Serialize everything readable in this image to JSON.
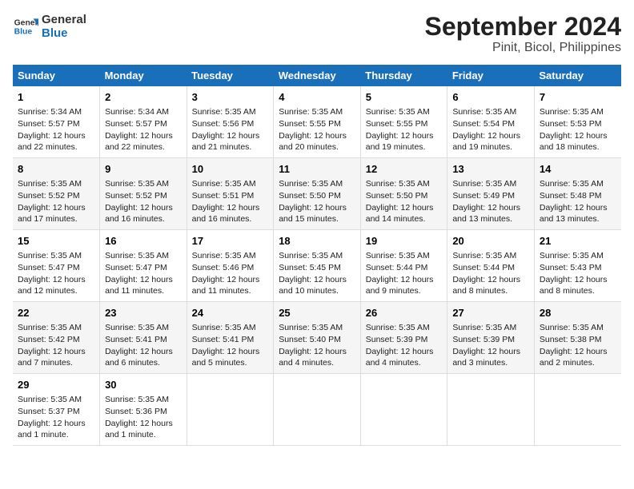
{
  "header": {
    "logo_line1": "General",
    "logo_line2": "Blue",
    "title": "September 2024",
    "subtitle": "Pinit, Bicol, Philippines"
  },
  "days_of_week": [
    "Sunday",
    "Monday",
    "Tuesday",
    "Wednesday",
    "Thursday",
    "Friday",
    "Saturday"
  ],
  "weeks": [
    [
      {
        "day": "1",
        "sunrise": "5:34 AM",
        "sunset": "5:57 PM",
        "daylight": "12 hours and 22 minutes."
      },
      {
        "day": "2",
        "sunrise": "5:34 AM",
        "sunset": "5:57 PM",
        "daylight": "12 hours and 22 minutes."
      },
      {
        "day": "3",
        "sunrise": "5:35 AM",
        "sunset": "5:56 PM",
        "daylight": "12 hours and 21 minutes."
      },
      {
        "day": "4",
        "sunrise": "5:35 AM",
        "sunset": "5:55 PM",
        "daylight": "12 hours and 20 minutes."
      },
      {
        "day": "5",
        "sunrise": "5:35 AM",
        "sunset": "5:55 PM",
        "daylight": "12 hours and 19 minutes."
      },
      {
        "day": "6",
        "sunrise": "5:35 AM",
        "sunset": "5:54 PM",
        "daylight": "12 hours and 19 minutes."
      },
      {
        "day": "7",
        "sunrise": "5:35 AM",
        "sunset": "5:53 PM",
        "daylight": "12 hours and 18 minutes."
      }
    ],
    [
      {
        "day": "8",
        "sunrise": "5:35 AM",
        "sunset": "5:52 PM",
        "daylight": "12 hours and 17 minutes."
      },
      {
        "day": "9",
        "sunrise": "5:35 AM",
        "sunset": "5:52 PM",
        "daylight": "12 hours and 16 minutes."
      },
      {
        "day": "10",
        "sunrise": "5:35 AM",
        "sunset": "5:51 PM",
        "daylight": "12 hours and 16 minutes."
      },
      {
        "day": "11",
        "sunrise": "5:35 AM",
        "sunset": "5:50 PM",
        "daylight": "12 hours and 15 minutes."
      },
      {
        "day": "12",
        "sunrise": "5:35 AM",
        "sunset": "5:50 PM",
        "daylight": "12 hours and 14 minutes."
      },
      {
        "day": "13",
        "sunrise": "5:35 AM",
        "sunset": "5:49 PM",
        "daylight": "12 hours and 13 minutes."
      },
      {
        "day": "14",
        "sunrise": "5:35 AM",
        "sunset": "5:48 PM",
        "daylight": "12 hours and 13 minutes."
      }
    ],
    [
      {
        "day": "15",
        "sunrise": "5:35 AM",
        "sunset": "5:47 PM",
        "daylight": "12 hours and 12 minutes."
      },
      {
        "day": "16",
        "sunrise": "5:35 AM",
        "sunset": "5:47 PM",
        "daylight": "12 hours and 11 minutes."
      },
      {
        "day": "17",
        "sunrise": "5:35 AM",
        "sunset": "5:46 PM",
        "daylight": "12 hours and 11 minutes."
      },
      {
        "day": "18",
        "sunrise": "5:35 AM",
        "sunset": "5:45 PM",
        "daylight": "12 hours and 10 minutes."
      },
      {
        "day": "19",
        "sunrise": "5:35 AM",
        "sunset": "5:44 PM",
        "daylight": "12 hours and 9 minutes."
      },
      {
        "day": "20",
        "sunrise": "5:35 AM",
        "sunset": "5:44 PM",
        "daylight": "12 hours and 8 minutes."
      },
      {
        "day": "21",
        "sunrise": "5:35 AM",
        "sunset": "5:43 PM",
        "daylight": "12 hours and 8 minutes."
      }
    ],
    [
      {
        "day": "22",
        "sunrise": "5:35 AM",
        "sunset": "5:42 PM",
        "daylight": "12 hours and 7 minutes."
      },
      {
        "day": "23",
        "sunrise": "5:35 AM",
        "sunset": "5:41 PM",
        "daylight": "12 hours and 6 minutes."
      },
      {
        "day": "24",
        "sunrise": "5:35 AM",
        "sunset": "5:41 PM",
        "daylight": "12 hours and 5 minutes."
      },
      {
        "day": "25",
        "sunrise": "5:35 AM",
        "sunset": "5:40 PM",
        "daylight": "12 hours and 4 minutes."
      },
      {
        "day": "26",
        "sunrise": "5:35 AM",
        "sunset": "5:39 PM",
        "daylight": "12 hours and 4 minutes."
      },
      {
        "day": "27",
        "sunrise": "5:35 AM",
        "sunset": "5:39 PM",
        "daylight": "12 hours and 3 minutes."
      },
      {
        "day": "28",
        "sunrise": "5:35 AM",
        "sunset": "5:38 PM",
        "daylight": "12 hours and 2 minutes."
      }
    ],
    [
      {
        "day": "29",
        "sunrise": "5:35 AM",
        "sunset": "5:37 PM",
        "daylight": "12 hours and 1 minute."
      },
      {
        "day": "30",
        "sunrise": "5:35 AM",
        "sunset": "5:36 PM",
        "daylight": "12 hours and 1 minute."
      },
      {
        "day": "",
        "sunrise": "",
        "sunset": "",
        "daylight": ""
      },
      {
        "day": "",
        "sunrise": "",
        "sunset": "",
        "daylight": ""
      },
      {
        "day": "",
        "sunrise": "",
        "sunset": "",
        "daylight": ""
      },
      {
        "day": "",
        "sunrise": "",
        "sunset": "",
        "daylight": ""
      },
      {
        "day": "",
        "sunrise": "",
        "sunset": "",
        "daylight": ""
      }
    ]
  ],
  "labels": {
    "sunrise": "Sunrise:",
    "sunset": "Sunset:",
    "daylight": "Daylight:"
  }
}
